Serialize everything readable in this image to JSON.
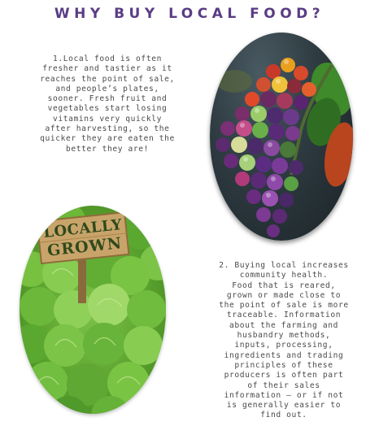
{
  "title": "WHY BUY LOCAL FOOD?",
  "section1": {
    "text": "1.Local food is often fresher and tastier as it reaches the point of sale, and people’s plates, sooner. Fresh fruit and vegetables start losing vitamins very quickly after harvesting, so the quicker they are eaten the better they are!"
  },
  "section2": {
    "heading": "2. Buying local increases community health.",
    "text": "Food that is reared, grown or made close to the point of sale is more traceable. Information about the farming and husbandry methods, inputs, processing, ingredients and trading principles of these producers is often part of their sales information – or if not is generally easier to find out."
  },
  "sign": {
    "line1": "LOCALLY",
    "line2": "GROWN"
  },
  "colors": {
    "title": "#5a3d84",
    "body_text": "#4a4a4a",
    "cabbage_green": "#6db83a",
    "sign_wood": "#c9a46a"
  },
  "images": {
    "grapes": "grapes-photo",
    "cabbages": "cabbages-photo"
  }
}
